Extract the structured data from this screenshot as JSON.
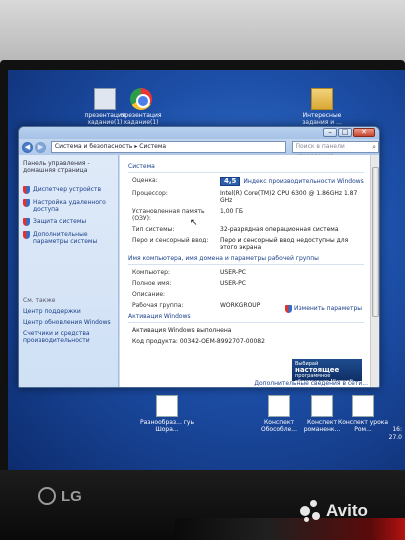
{
  "desktop": {
    "icons": [
      {
        "label": "презентация хадание(1)",
        "icon": "presentation-icon"
      },
      {
        "label": "презентация хадание(1)",
        "icon": "chrome-icon"
      },
      {
        "label": "Интересные задания и ...",
        "icon": "folder-icon"
      },
      {
        "label": "Разнообраз... гуь Шора...",
        "icon": "document-icon"
      },
      {
        "label": "Конспект Обособле...",
        "icon": "document-icon"
      },
      {
        "label": "Конспект романенк...",
        "icon": "document-icon"
      },
      {
        "label": "Конспект урока Ром...",
        "icon": "document-icon"
      }
    ],
    "clock": {
      "time": "16:",
      "date": "27.0"
    }
  },
  "window": {
    "address": "Система и безопасность  ▸  Система",
    "search_placeholder": "Поиск в панели управления",
    "left_pane": {
      "home": "Панель управления - домашняя страница",
      "links": [
        "Диспетчер устройств",
        "Настройка удаленного доступа",
        "Защита системы",
        "Дополнительные параметры системы"
      ],
      "see_also": "См. также",
      "see_also_links": [
        "Центр поддержки",
        "Центр обновления Windows",
        "Счетчики и средства производительности"
      ]
    },
    "system": {
      "section": "Система",
      "rows": [
        {
          "k": "Оценка:",
          "v": ""
        },
        {
          "k": "Процессор:",
          "v": "Intel(R) Core(TM)2 CPU        6300  @ 1.86GHz   1.87 GHz"
        },
        {
          "k": "Установленная память (ОЗУ):",
          "v": "1,00 ГБ"
        },
        {
          "k": "Тип системы:",
          "v": "32-разрядная операционная система"
        },
        {
          "k": "Перо и сенсорный ввод:",
          "v": "Перо и сенсорный ввод недоступны для этого экрана"
        }
      ],
      "score": "4,5",
      "score_link": "Индекс производительности Windows"
    },
    "computer": {
      "section": "Имя компьютера, имя домена и параметры рабочей группы",
      "rows": [
        {
          "k": "Компьютер:",
          "v": "USER-PC"
        },
        {
          "k": "Полное имя:",
          "v": "USER-PC"
        },
        {
          "k": "Описание:",
          "v": ""
        },
        {
          "k": "Рабочая группа:",
          "v": "WORKGROUP"
        }
      ],
      "change_link": "Изменить параметры"
    },
    "activation": {
      "section": "Активация Windows",
      "status": "Активация Windows выполнена",
      "product_key": "Код продукта: 00342-OEM-8992707-00082",
      "genuine_top": "Выбирай",
      "genuine_main": "настоящее",
      "genuine_sub": "программное обеспечение Microsoft",
      "more_link": "Дополнительные сведения в сети..."
    }
  },
  "monitor": {
    "brand": "LG"
  },
  "watermark": {
    "text": "Avito"
  }
}
